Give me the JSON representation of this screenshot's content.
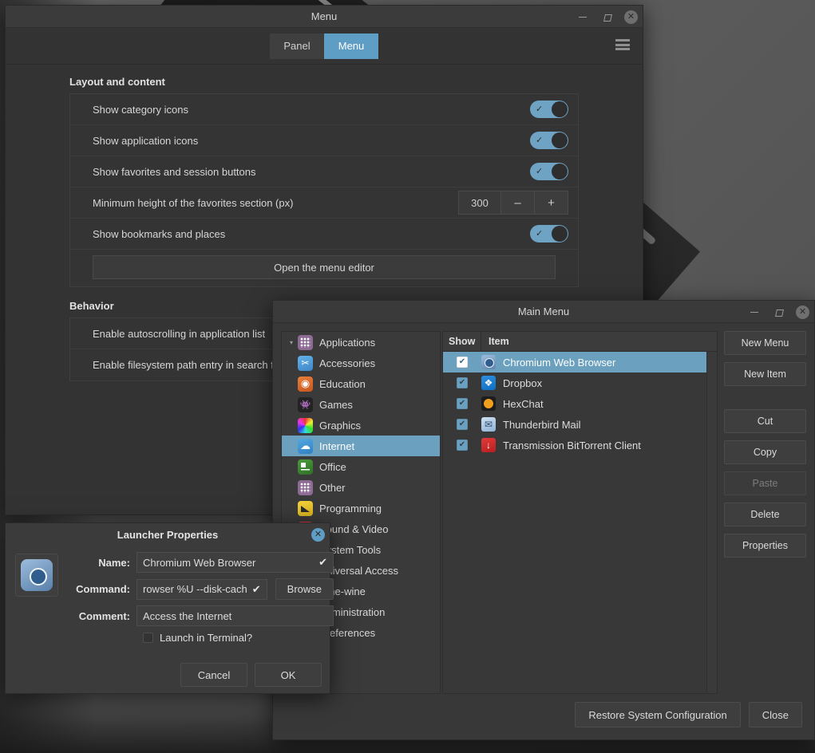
{
  "menu_window": {
    "title": "Menu",
    "tabs": [
      {
        "label": "Panel",
        "active": false
      },
      {
        "label": "Menu",
        "active": true
      }
    ],
    "hamburger_icon": "hamburger-menu-icon",
    "controls": {
      "minimize": "minimize-icon",
      "maximize": "maximize-icon",
      "close": "close-icon"
    },
    "sections": [
      {
        "label": "Layout and content",
        "rows": [
          {
            "label": "Show category icons",
            "control": "toggle",
            "value": "on"
          },
          {
            "label": "Show application icons",
            "control": "toggle",
            "value": "on"
          },
          {
            "label": "Show favorites and session buttons",
            "control": "toggle",
            "value": "on"
          },
          {
            "label": "Minimum height of the favorites section (px)",
            "control": "spinner",
            "value": "300",
            "minus_label": "–",
            "plus_label": "+"
          },
          {
            "label": "Show bookmarks and places",
            "control": "toggle",
            "value": "on"
          }
        ],
        "button": "Open the menu editor"
      },
      {
        "label": "Behavior",
        "rows": [
          {
            "label": "Enable autoscrolling in application list",
            "control": "toggle",
            "value": "on"
          },
          {
            "label": "Enable filesystem path entry in search field",
            "control": "toggle",
            "value": "on"
          }
        ]
      }
    ]
  },
  "main_menu_window": {
    "title": "Main Menu",
    "controls": {
      "minimize": "minimize-icon",
      "maximize": "maximize-icon",
      "close": "close-icon"
    },
    "tree": {
      "root": {
        "label": "Applications",
        "icon": "grid-icon",
        "expanded": true,
        "arrow": "▾"
      },
      "categories": [
        {
          "label": "Accessories",
          "icon": "scissors-icon",
          "selected": false
        },
        {
          "label": "Education",
          "icon": "education-icon",
          "selected": false
        },
        {
          "label": "Games",
          "icon": "games-icon",
          "selected": false
        },
        {
          "label": "Graphics",
          "icon": "graphics-icon",
          "selected": false
        },
        {
          "label": "Internet",
          "icon": "cloud-icon",
          "selected": true
        },
        {
          "label": "Office",
          "icon": "office-icon",
          "selected": false
        },
        {
          "label": "Other",
          "icon": "grid-icon",
          "selected": false
        },
        {
          "label": "Programming",
          "icon": "programming-icon",
          "selected": false
        },
        {
          "label": "Sound & Video",
          "icon": "sound-video-icon",
          "selected": false
        },
        {
          "label": "System Tools",
          "icon": "system-tools-icon",
          "selected": false
        },
        {
          "label": "Universal Access",
          "icon": "universal-access-icon",
          "selected": false
        },
        {
          "label": "wine-wine",
          "icon": "wine-icon",
          "selected": false
        },
        {
          "label": "Administration",
          "icon": "administration-icon",
          "selected": false
        },
        {
          "label": "Preferences",
          "icon": "preferences-icon",
          "selected": false
        }
      ]
    },
    "item_list": {
      "columns": [
        "Show",
        "Item"
      ],
      "rows": [
        {
          "show": true,
          "name": "Chromium Web Browser",
          "icon": "chromium-icon",
          "selected": true
        },
        {
          "show": true,
          "name": "Dropbox",
          "icon": "dropbox-icon",
          "selected": false
        },
        {
          "show": true,
          "name": "HexChat",
          "icon": "hexchat-icon",
          "selected": false
        },
        {
          "show": true,
          "name": "Thunderbird Mail",
          "icon": "thunderbird-icon",
          "selected": false
        },
        {
          "show": true,
          "name": "Transmission BitTorrent Client",
          "icon": "transmission-icon",
          "selected": false
        }
      ],
      "check_glyph": "✔"
    },
    "side_buttons": [
      {
        "label": "New Menu",
        "disabled": false
      },
      {
        "label": "New Item",
        "disabled": false
      },
      {
        "label": "Cut",
        "disabled": false
      },
      {
        "label": "Copy",
        "disabled": false
      },
      {
        "label": "Paste",
        "disabled": true
      },
      {
        "label": "Delete",
        "disabled": false
      },
      {
        "label": "Properties",
        "disabled": false
      }
    ],
    "footer_buttons": [
      {
        "label": "Restore System Configuration"
      },
      {
        "label": "Close"
      }
    ]
  },
  "launcher_dialog": {
    "title": "Launcher Properties",
    "close_icon": "close-icon",
    "app_icon": "chromium-launcher-icon",
    "fields": [
      {
        "label": "Name:",
        "value": "Chromium Web Browser",
        "tick": "✔"
      },
      {
        "label": "Command:",
        "value": "rowser %U --disk-cach",
        "tick": "✔",
        "browse_label": "Browse"
      },
      {
        "label": "Comment:",
        "value": "Access the Internet",
        "tick": ""
      }
    ],
    "terminal_checkbox": {
      "label": "Launch in Terminal?",
      "checked": false
    },
    "buttons": [
      {
        "label": "Cancel"
      },
      {
        "label": "OK"
      }
    ]
  },
  "colors": {
    "accent_blue": "#6ba0bf",
    "tab_active": "#5e9dc4",
    "window_bg": "#353535",
    "text": "#d8d8d8"
  }
}
